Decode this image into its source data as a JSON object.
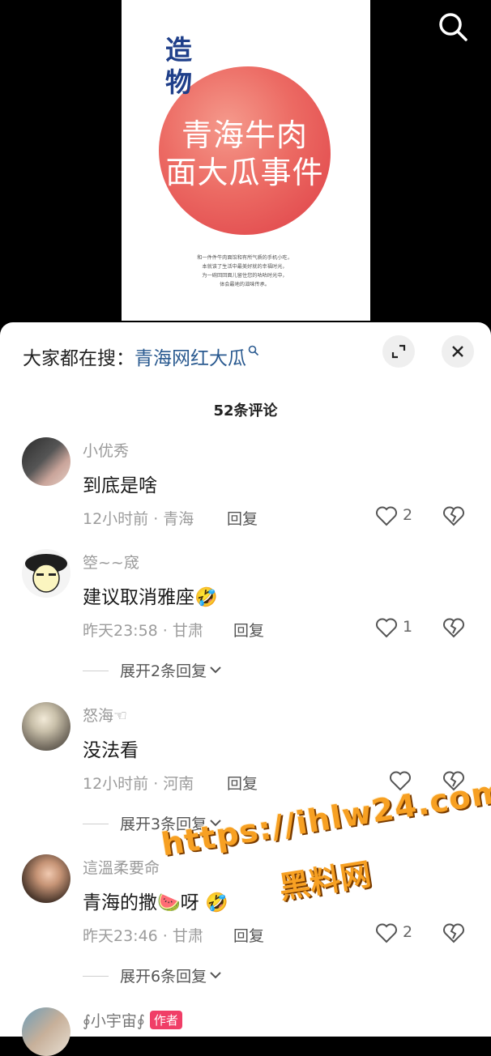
{
  "video": {
    "cover_side_title": "造物",
    "cover_title_line1": "青海牛肉",
    "cover_title_line2": "面大瓜事件",
    "cover_desc_line1": "和一件件牛肉面馆和有所气质的手机小吃，",
    "cover_desc_line2": "本就该了生活中最美好就的幸福时光，",
    "cover_desc_line3": "为一碗回回面儿留住您的咕咕时光中，",
    "cover_desc_line4": "体会最地的滋味传承。",
    "search_icon": "search-icon"
  },
  "sheet": {
    "hot_search_prefix": "大家都在搜：",
    "hot_search_term": "青海网红大瓜",
    "expand_icon": "expand-icon",
    "close_icon": "close-icon",
    "comment_count": "52条评论"
  },
  "comments": [
    {
      "user": "小优秀",
      "text": "到底是啥",
      "meta": "12小时前 · 青海",
      "reply": "回复",
      "likes": "2",
      "expand": ""
    },
    {
      "user": "箜~~窚",
      "text": "建议取消雅座🤣",
      "meta": "昨天23:58 · 甘肃",
      "reply": "回复",
      "likes": "1",
      "expand": "展开2条回复"
    },
    {
      "user": "怒海☜",
      "text": "没法看",
      "meta": "12小时前 · 河南",
      "reply": "回复",
      "likes": "",
      "expand": "展开3条回复"
    },
    {
      "user": "這溫柔要命",
      "text": "青海的撒🍉呀 🤣",
      "meta": "昨天23:46 · 甘肃",
      "reply": "回复",
      "likes": "2",
      "expand": "展开6条回复"
    },
    {
      "user": "∮小宇宙∮",
      "badge": "作者"
    }
  ],
  "watermark": {
    "url": "https://ihlw24.com",
    "name": "黑料网"
  },
  "colors": {
    "accent_link": "#2a5a90",
    "badge": "#f03e67",
    "watermark": "#f7a022"
  }
}
